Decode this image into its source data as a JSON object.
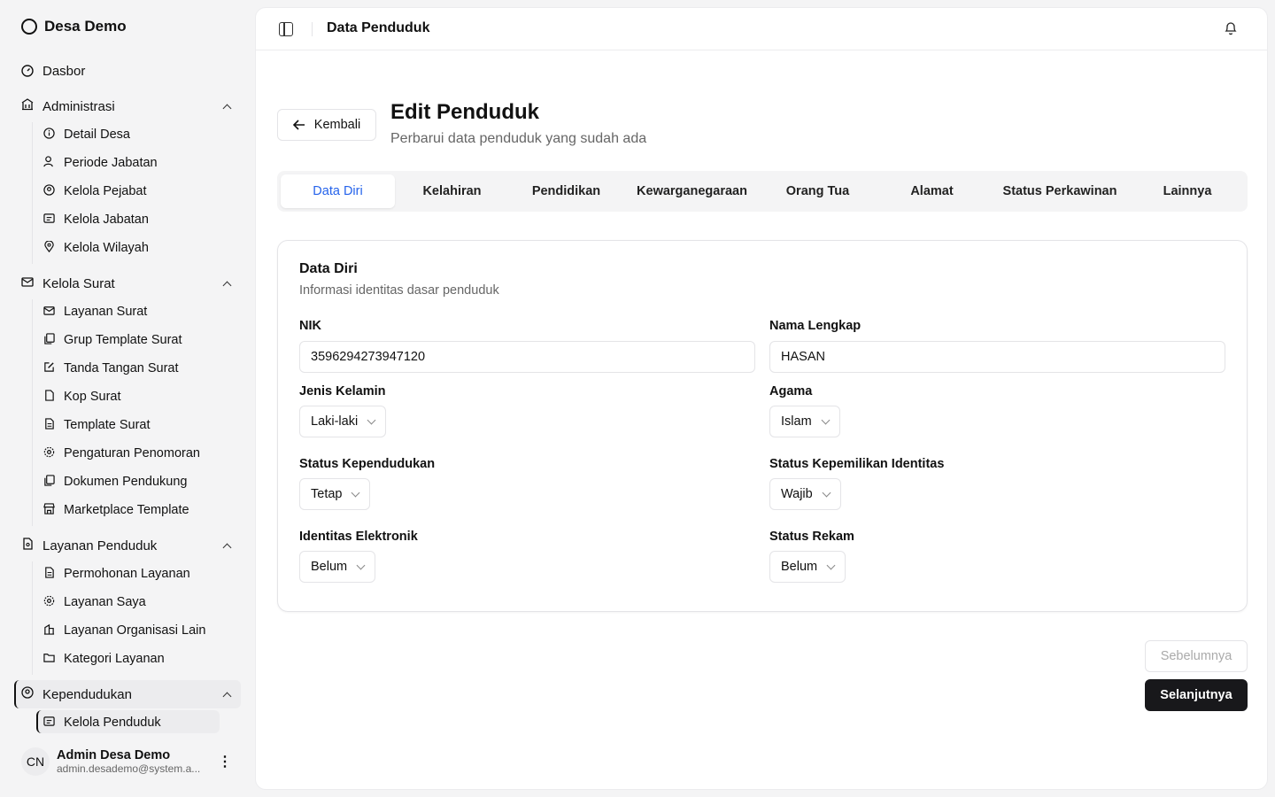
{
  "brand": {
    "name": "Desa Demo"
  },
  "sidebar": {
    "dashboard": "Dasbor",
    "groups": [
      {
        "label": "Administrasi",
        "items": [
          "Detail Desa",
          "Periode Jabatan",
          "Kelola Pejabat",
          "Kelola Jabatan",
          "Kelola Wilayah"
        ]
      },
      {
        "label": "Kelola Surat",
        "items": [
          "Layanan Surat",
          "Grup Template Surat",
          "Tanda Tangan Surat",
          "Kop Surat",
          "Template Surat",
          "Pengaturan Penomoran",
          "Dokumen Pendukung",
          "Marketplace Template"
        ]
      },
      {
        "label": "Layanan Penduduk",
        "items": [
          "Permohonan Layanan",
          "Layanan Saya",
          "Layanan Organisasi Lain",
          "Kategori Layanan"
        ]
      },
      {
        "label": "Kependudukan",
        "items": [
          "Kelola Penduduk"
        ]
      }
    ]
  },
  "user": {
    "initials": "CN",
    "name": "Admin Desa Demo",
    "email": "admin.desademo@system.a..."
  },
  "header": {
    "breadcrumb": "Data Penduduk"
  },
  "page": {
    "back_label": "Kembali",
    "title": "Edit Penduduk",
    "subtitle": "Perbarui data penduduk yang sudah ada"
  },
  "tabs": [
    "Data Diri",
    "Kelahiran",
    "Pendidikan",
    "Kewarganegaraan",
    "Orang Tua",
    "Alamat",
    "Status Perkawinan",
    "Lainnya"
  ],
  "active_tab": "Data Diri",
  "form": {
    "title": "Data Diri",
    "description": "Informasi identitas dasar penduduk",
    "nik": {
      "label": "NIK",
      "value": "3596294273947120"
    },
    "nama": {
      "label": "Nama Lengkap",
      "value": "HASAN"
    },
    "jenis_kelamin": {
      "label": "Jenis Kelamin",
      "value": "Laki-laki"
    },
    "agama": {
      "label": "Agama",
      "value": "Islam"
    },
    "status_kependudukan": {
      "label": "Status Kependudukan",
      "value": "Tetap"
    },
    "status_kepemilikan": {
      "label": "Status Kepemilikan Identitas",
      "value": "Wajib"
    },
    "identitas_elektronik": {
      "label": "Identitas Elektronik",
      "value": "Belum"
    },
    "status_rekam": {
      "label": "Status Rekam",
      "value": "Belum"
    }
  },
  "footer": {
    "prev_label": "Sebelumnya",
    "next_label": "Selanjutnya"
  },
  "colors": {
    "accent": "#2563eb",
    "primary_button": "#18181b",
    "active_bg": "#ececee"
  }
}
